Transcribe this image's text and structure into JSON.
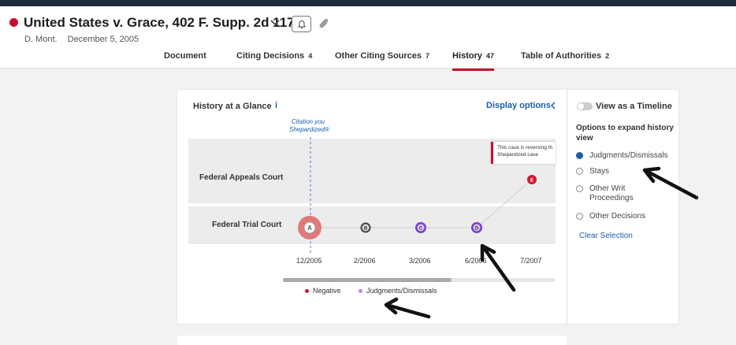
{
  "case": {
    "title": "United States v. Grace, 402 F. Supp. 2d 1178",
    "court": "D. Mont.",
    "date": "December 5, 2005"
  },
  "tabs": [
    {
      "label": "Document",
      "count": ""
    },
    {
      "label": "Citing Decisions",
      "count": "4"
    },
    {
      "label": "Other Citing Sources",
      "count": "7"
    },
    {
      "label": "History",
      "count": "47",
      "active": true
    },
    {
      "label": "Table of Authorities",
      "count": "2"
    }
  ],
  "history_panel": {
    "title": "History at a Glance",
    "info_icon": "i",
    "display_options": "Display options",
    "citation_marker": [
      "Citation you",
      "Shepardized®"
    ],
    "rows": [
      "Federal Appeals Court",
      "Federal Trial Court"
    ],
    "callout": [
      "This case is reversing th",
      "Shepardized case"
    ],
    "nodes": [
      {
        "letter": "A",
        "type": "negative-large"
      },
      {
        "letter": "B",
        "type": "neutral"
      },
      {
        "letter": "C",
        "type": "judgment"
      },
      {
        "letter": "D",
        "type": "judgment"
      },
      {
        "letter": "E",
        "type": "negative"
      }
    ],
    "dates": [
      "12/2005",
      "2/2006",
      "3/2006",
      "6/2006",
      "7/2007"
    ],
    "legend": [
      {
        "label": "Negative",
        "color": "#d0192e"
      },
      {
        "label": "Judgments/Dismissals",
        "color": "#b48be0"
      }
    ]
  },
  "options_panel": {
    "timeline_toggle": "View as a Timeline",
    "title": "Options to expand history view",
    "options": [
      {
        "label": "Judgments/Dismissals",
        "checked": true
      },
      {
        "label": "Stays",
        "checked": false
      },
      {
        "label": "Other Writ Proceedings",
        "checked": false
      },
      {
        "label": "Other Decisions",
        "checked": false
      }
    ],
    "clear": "Clear Selection"
  },
  "colors": {
    "brand_red": "#c8102e",
    "link_blue": "#1a5ea8",
    "topbar": "#1f2b3d"
  }
}
